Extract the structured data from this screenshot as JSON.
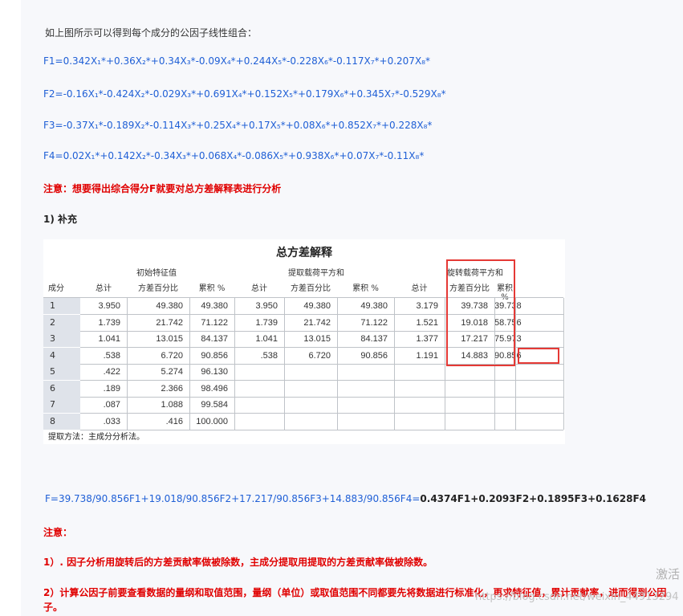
{
  "intro": "如上图所示可以得到每个成分的公因子线性组合：",
  "formulas": {
    "f1": "F1=0.342X₁*+0.36X₂*+0.34X₃*-0.09X₄*+0.244X₅*-0.228X₆*-0.117X₇*+0.207X₈*",
    "f2": "F2=-0.16X₁*-0.424X₂*-0.029X₃*+0.691X₄*+0.152X₅*+0.179X₆*+0.345X₇*-0.529X₈*",
    "f3": "F3=-0.37X₁*-0.189X₂*-0.114X₃*+0.25X₄*+0.17X₅*+0.08X₆*+0.852X₇*+0.228X₈*",
    "f4": "F4=0.02X₁*+0.142X₂*-0.34X₃*+0.068X₄*-0.086X₅*+0.938X₆*+0.07X₇*-0.11X₈*"
  },
  "note1": "注意：想要得出综合得分F就要对总方差解释表进行分析",
  "section": "1) 补充",
  "table": {
    "title": "总方差解释",
    "groups": [
      "初始特征值",
      "提取载荷平方和",
      "旋转载荷平方和"
    ],
    "row_header": "成分",
    "sub_headers": [
      "总计",
      "方差百分比",
      "累积 %",
      "总计",
      "方差百分比",
      "累积 %",
      "总计",
      "方差百分比",
      "累积 %"
    ],
    "rows": [
      [
        "1",
        "3.950",
        "49.380",
        "49.380",
        "3.950",
        "49.380",
        "49.380",
        "3.179",
        "39.738",
        "39.738"
      ],
      [
        "2",
        "1.739",
        "21.742",
        "71.122",
        "1.739",
        "21.742",
        "71.122",
        "1.521",
        "19.018",
        "58.756"
      ],
      [
        "3",
        "1.041",
        "13.015",
        "84.137",
        "1.041",
        "13.015",
        "84.137",
        "1.377",
        "17.217",
        "75.973"
      ],
      [
        "4",
        ".538",
        "6.720",
        "90.856",
        ".538",
        "6.720",
        "90.856",
        "1.191",
        "14.883",
        "90.856"
      ],
      [
        "5",
        ".422",
        "5.274",
        "96.130",
        "",
        "",
        "",
        "",
        "",
        ""
      ],
      [
        "6",
        ".189",
        "2.366",
        "98.496",
        "",
        "",
        "",
        "",
        "",
        ""
      ],
      [
        "7",
        ".087",
        "1.088",
        "99.584",
        "",
        "",
        "",
        "",
        "",
        ""
      ],
      [
        "8",
        ".033",
        ".416",
        "100.000",
        "",
        "",
        "",
        "",
        "",
        ""
      ]
    ],
    "footnote": "提取方法：主成分分析法。"
  },
  "final_formula_prefix": "F=39.738/90.856F1+19.018/90.856F2+17.217/90.856F3+14.883/90.856F4=",
  "final_formula_result": "0.4374F1+0.2093F2+0.1895F3+0.1628F4",
  "note2_title": "注意：",
  "note2_item1": "1）. 因子分析用旋转后的方差贡献率做被除数，主成分提取用提取的方差贡献率做被除数。",
  "note2_item2": "2）计算公因子前要查看数据的量纲和取值范围，量纲（单位）或取值范围不同都要先将数据进行标准化，再求特征值，累计贡献率，进而得到公因子。",
  "watermark": "激活",
  "url_watermark": "https://blog.csdn.net/weixin_44913294"
}
